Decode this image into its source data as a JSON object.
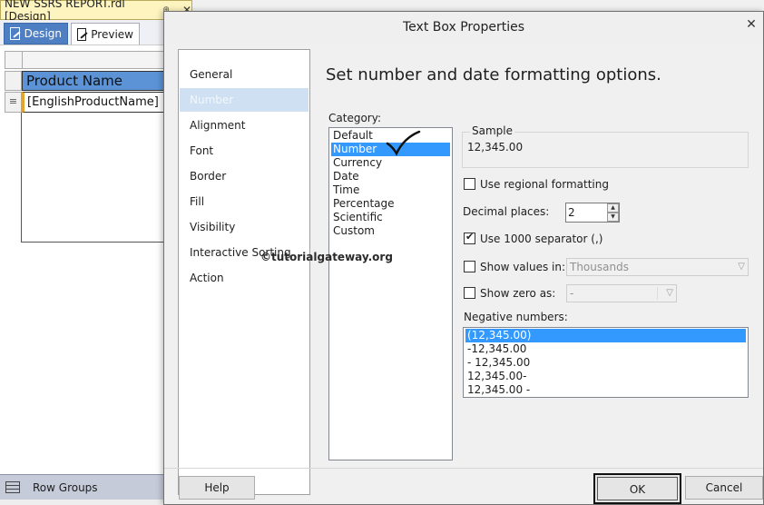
{
  "designer": {
    "doc_tab_title": "NEW SSRS REPORT.rdl [Design]",
    "pin_glyph": "⊕",
    "close_glyph": "✕",
    "tabs": [
      {
        "label": "Design",
        "icon": "design-view-icon"
      },
      {
        "label": "Preview",
        "icon": "preview-icon"
      }
    ],
    "header_cell": "Product Name",
    "data_cell": "[EnglishProductName]",
    "row_handle_glyph": "≡",
    "row_groups_label": "Row Groups"
  },
  "dialog": {
    "title": "Text Box Properties",
    "close_glyph": "✕",
    "nav_items": [
      "General",
      "Number",
      "Alignment",
      "Font",
      "Border",
      "Fill",
      "Visibility",
      "Interactive Sorting",
      "Action"
    ],
    "selected_nav": "Number",
    "heading": "Set number and date formatting options.",
    "category_label": "Category:",
    "categories": [
      "Default",
      "Number",
      "Currency",
      "Date",
      "Time",
      "Percentage",
      "Scientific",
      "Custom"
    ],
    "selected_category": "Number",
    "sample_label": "Sample",
    "sample_value": "12,345.00",
    "use_regional_formatting": {
      "label": "Use regional formatting",
      "checked": false
    },
    "decimal_places": {
      "label": "Decimal places:",
      "value": "2"
    },
    "use_1000_separator": {
      "label": "Use 1000 separator (,)",
      "checked": true
    },
    "show_values_in": {
      "label": "Show values in:",
      "checked": false,
      "value": "Thousands"
    },
    "show_zero_as": {
      "label": "Show zero as:",
      "checked": false,
      "value": "-"
    },
    "negative_numbers_label": "Negative numbers:",
    "negative_numbers": [
      "(12,345.00)",
      "-12,345.00",
      "- 12,345.00",
      "12,345.00-",
      "12,345.00 -"
    ],
    "selected_negative": "(12,345.00)",
    "watermark": "©tutorialgateway.org",
    "buttons": {
      "help": "Help",
      "ok": "OK",
      "cancel": "Cancel"
    }
  }
}
